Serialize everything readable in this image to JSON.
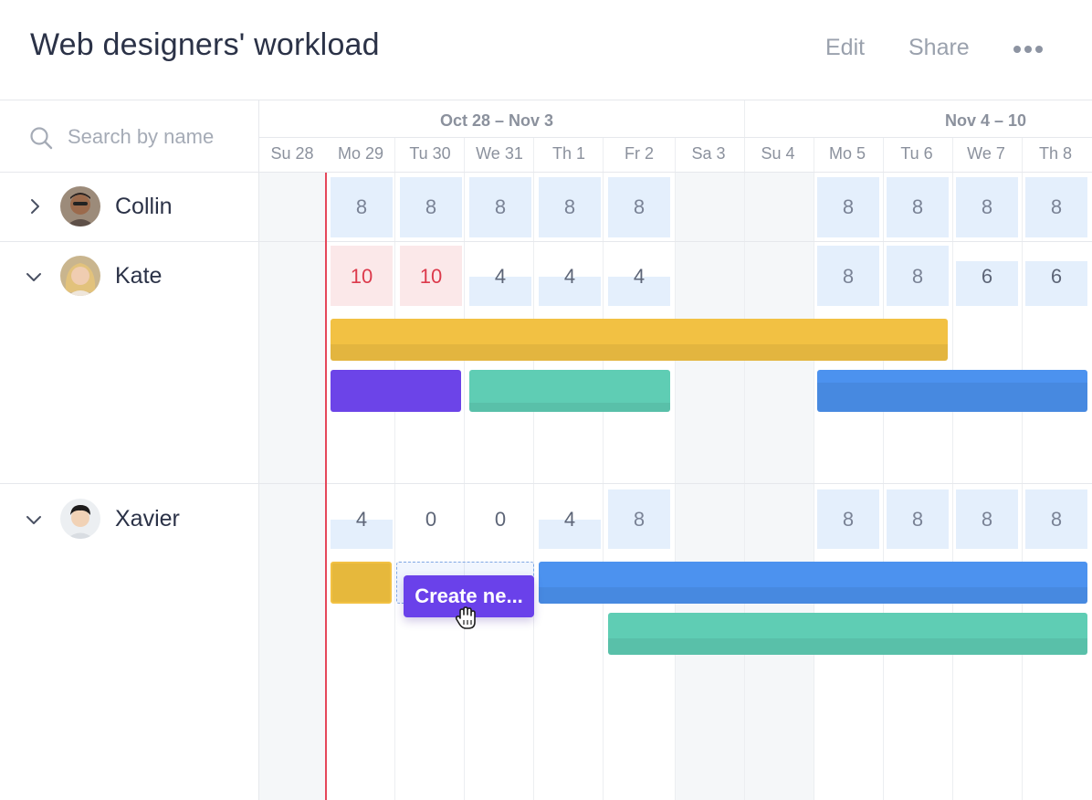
{
  "header": {
    "title": "Web designers' workload",
    "edit_label": "Edit",
    "share_label": "Share",
    "more_icon": "more-horizontal-icon"
  },
  "search": {
    "placeholder": "Search by name",
    "value": ""
  },
  "timeline": {
    "weeks": [
      {
        "label": "Oct 28 –  Nov 3"
      },
      {
        "label": "Nov 4 – 10"
      }
    ],
    "days": [
      "Su 28",
      "Mo 29",
      "Tu 30",
      "We 31",
      "Th 1",
      "Fr 2",
      "Sa 3",
      "Su 4",
      "Mo 5",
      "Tu 6",
      "We 7",
      "Th 8"
    ]
  },
  "people": [
    {
      "name": "Collin",
      "expanded": false,
      "hours": [
        "",
        "8",
        "8",
        "8",
        "8",
        "8",
        "",
        "",
        "8",
        "8",
        "8",
        "8"
      ]
    },
    {
      "name": "Kate",
      "expanded": true,
      "hours": [
        "",
        "10",
        "10",
        "4",
        "4",
        "4",
        "",
        "",
        "8",
        "8",
        "6",
        "6"
      ]
    },
    {
      "name": "Xavier",
      "expanded": true,
      "hours": [
        "",
        "4",
        "0",
        "0",
        "4",
        "8",
        "",
        "",
        "8",
        "8",
        "8",
        "8"
      ]
    }
  ],
  "create_button": {
    "label": "Create ne..."
  },
  "colors": {
    "today_line": "#e5475a",
    "task_yellow": "#f2c143",
    "task_purple": "#6c44e8",
    "task_teal": "#5fcdb4",
    "task_blue": "#4c92ef",
    "capacity_cell": "#e4effc",
    "overload_cell": "#fbe8e9",
    "overload_text": "#dc3a4c"
  }
}
